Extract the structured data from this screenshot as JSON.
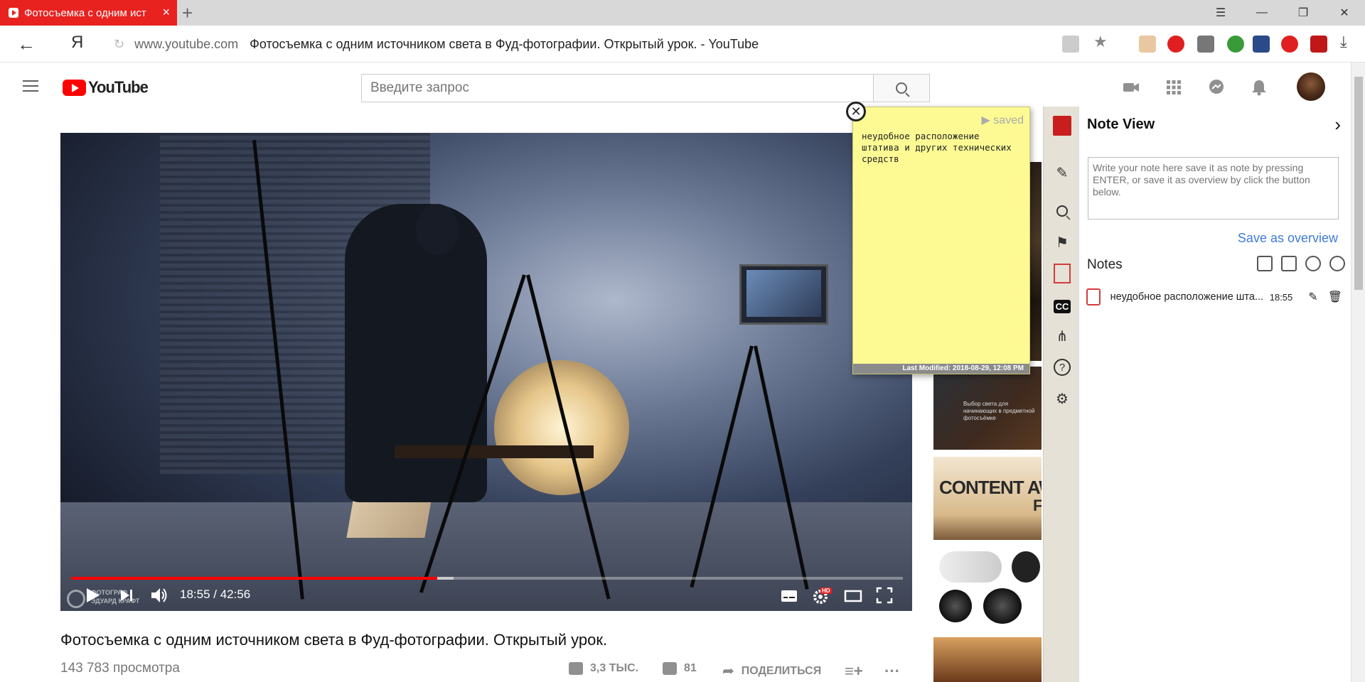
{
  "browser": {
    "tab_title": "Фотосъемка с одним ист",
    "url_domain": "www.youtube.com",
    "page_title": "Фотосъемка с одним источником света в Фуд-фотографии. Открытый урок. - YouTube",
    "yandex_logo": "Я",
    "accent": "#e8221f"
  },
  "youtube": {
    "logo_text": "YouTube",
    "search_placeholder": "Введите запрос"
  },
  "video": {
    "current_time": "18:55",
    "duration": "42:56",
    "time_display": "18:55 / 42:56",
    "progress_played": 0.44,
    "progress_buffered": 0.46,
    "quality_badge": "HD",
    "watermark_line1": "ФОТОГРАФ",
    "watermark_line2": "ЭДУАРД КРАФТ"
  },
  "meta": {
    "title": "Фотосъемка с одним источником света в Фуд-фотографии. Открытый урок.",
    "views": "143 783 просмотра",
    "likes": "3,3 ТЫС.",
    "dislikes": "81",
    "share": "ПОДЕЛИТЬСЯ"
  },
  "recommendations": {
    "thumb2_caption": "Выбор света для начинающих в предметной фотосъёмке",
    "thumb3_caption": "CONTENT AWA",
    "thumb3_sub": "F"
  },
  "sticky": {
    "status": "saved",
    "text": "неудобное расположение штатива и других технических средств",
    "modified": "Last Modified: 2018-08-29, 12:08 PM"
  },
  "note_panel": {
    "title": "Note View",
    "textarea_placeholder": "Write your note here save it as note by pressing ENTER, or save it as overview by click the button below.",
    "save_overview": "Save as overview",
    "notes_label": "Notes",
    "notes": [
      {
        "text": "неудобное расположение шта...",
        "time": "18:55"
      }
    ]
  }
}
